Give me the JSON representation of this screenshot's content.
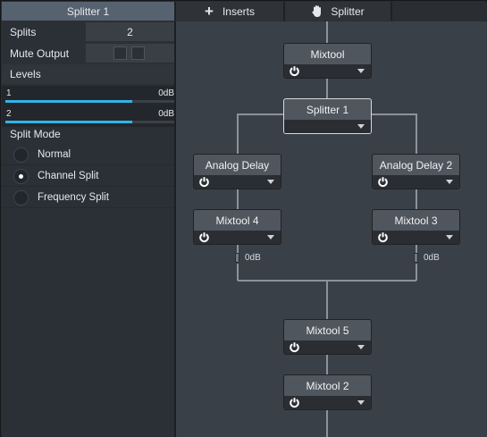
{
  "tabs": {
    "active_label": "Splitter 1",
    "inserts_label": "Inserts",
    "splitter_label": "Splitter"
  },
  "panel": {
    "splits_label": "Splits",
    "splits_value": "2",
    "mute_label": "Mute Output",
    "levels_label": "Levels",
    "levels": [
      {
        "index": "1",
        "value": "0dB",
        "fill_fraction": 0.75
      },
      {
        "index": "2",
        "value": "0dB",
        "fill_fraction": 0.75
      }
    ],
    "split_mode_label": "Split Mode",
    "split_modes": [
      {
        "label": "Normal",
        "selected": false
      },
      {
        "label": "Channel Split",
        "selected": true
      },
      {
        "label": "Frequency Split",
        "selected": false
      }
    ]
  },
  "routing": {
    "nodes": {
      "mixtool": "Mixtool",
      "splitter1": "Splitter 1",
      "analog_delay": "Analog Delay",
      "analog_delay2": "Analog Delay 2",
      "mixtool4": "Mixtool 4",
      "mixtool3": "Mixtool 3",
      "mixtool5": "Mixtool 5",
      "mixtool2": "Mixtool 2"
    },
    "gain_left": "0dB",
    "gain_right": "0dB"
  },
  "colors": {
    "accent": "#31b4e8",
    "active_tab": "#566270",
    "canvas": "#3a4047",
    "wire": "#8a939c"
  },
  "icons": [
    "plus-icon",
    "hand-icon",
    "power-icon",
    "dropdown-arrow-icon"
  ]
}
